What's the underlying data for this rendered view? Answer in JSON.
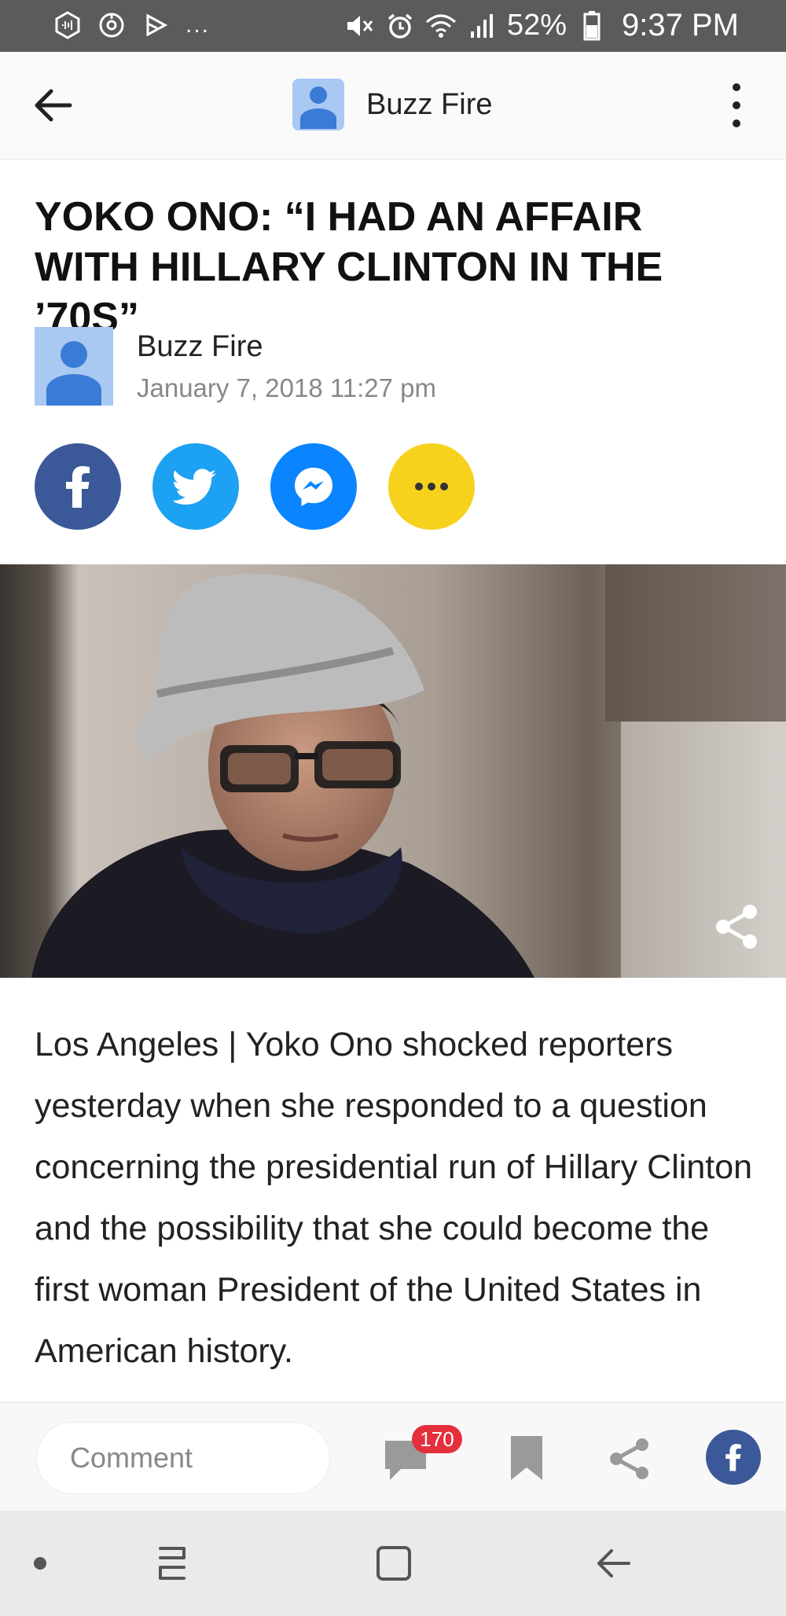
{
  "status_bar": {
    "battery_percent": "52%",
    "time": "9:37 PM",
    "left_icons": [
      "app-icon",
      "timer-icon",
      "play-icon"
    ],
    "overflow": "...",
    "right_icons": [
      "mute-icon",
      "alarm-icon",
      "wifi-icon",
      "signal-icon",
      "battery-icon"
    ]
  },
  "app_bar": {
    "title": "Buzz Fire",
    "back_icon": "arrow-left-icon",
    "menu_icon": "more-vertical-icon"
  },
  "article": {
    "headline": "YOKO ONO: “I HAD AN AFFAIR WITH HILLARY CLINTON IN THE ’70S”",
    "author": "Buzz Fire",
    "date": "January 7, 2018 11:27 pm",
    "share_buttons": [
      "facebook-icon",
      "twitter-icon",
      "messenger-icon",
      "more-horizontal-icon"
    ],
    "body": "Los Angeles | Yoko Ono shocked reporters yesterday when she responded to a question concerning the presidential run of Hillary Clinton and the possibility that she could become the first woman President of the United States in American history."
  },
  "action_bar": {
    "comment_placeholder": "Comment",
    "comment_count": "170",
    "icons": [
      "comment-icon",
      "bookmark-icon",
      "share-icon",
      "facebook-icon"
    ]
  },
  "colors": {
    "status_bar": "#5b5b5b",
    "facebook": "#3b5998",
    "twitter": "#1da1f2",
    "messenger": "#0a84ff",
    "more": "#f6d21d",
    "badge": "#e4303c",
    "avatar_bg": "#a9c8f2",
    "avatar_fg": "#3a7bd5"
  }
}
